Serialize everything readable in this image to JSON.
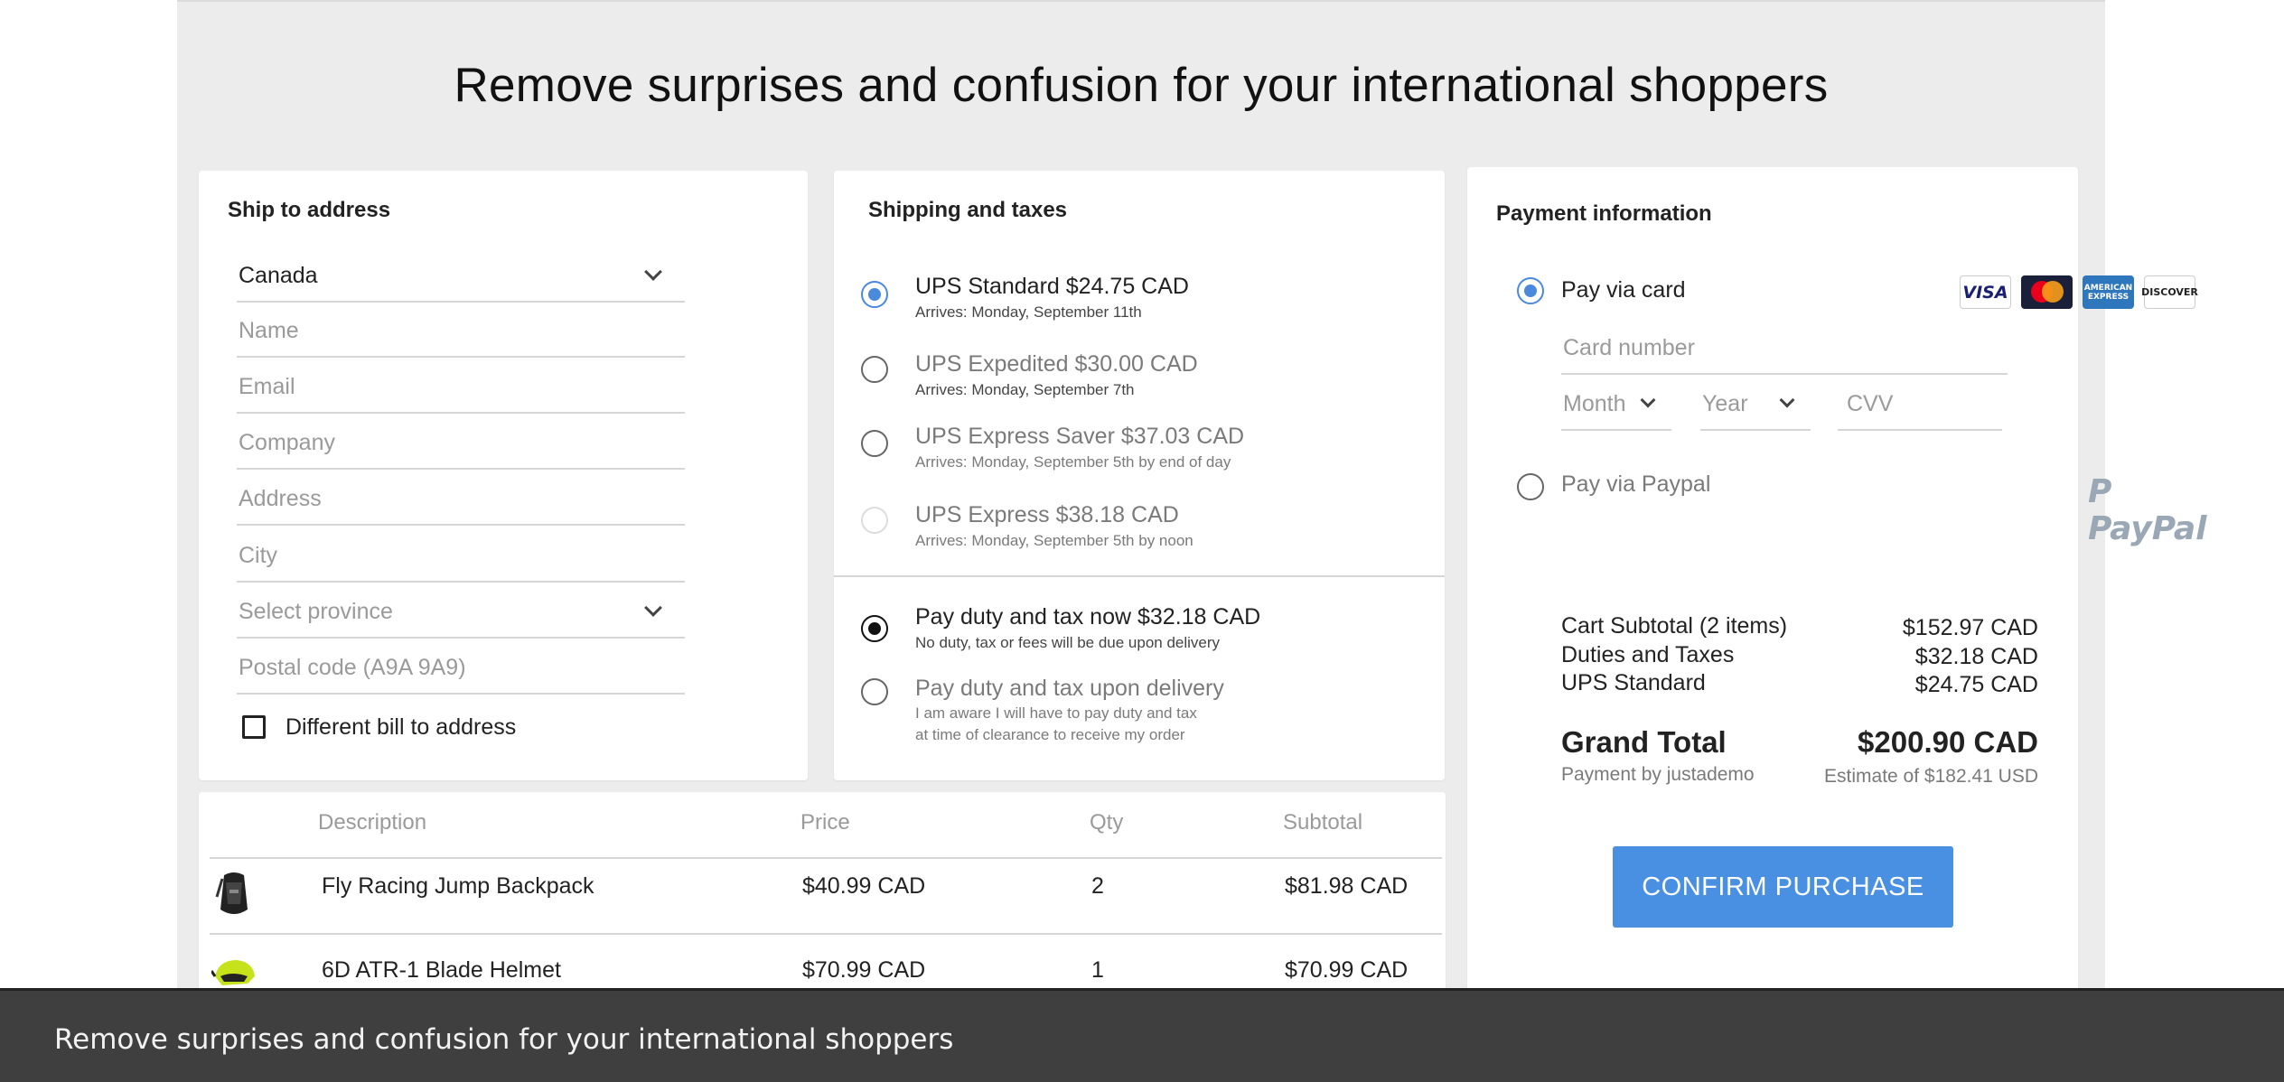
{
  "title": "Remove surprises and confusion for your international shoppers",
  "ship": {
    "heading": "Ship to address",
    "country": "Canada",
    "name_placeholder": "Name",
    "email_placeholder": "Email",
    "company_placeholder": "Company",
    "address_placeholder": "Address",
    "city_placeholder": "City",
    "province_placeholder": "Select province",
    "postal_placeholder": "Postal code (A9A 9A9)",
    "bill_label": "Different bill to address",
    "bill_checked": false
  },
  "shipping": {
    "heading": "Shipping and taxes",
    "options": [
      {
        "label": "UPS Standard $24.75 CAD",
        "sub": "Arrives: Monday, September 11th",
        "selected": true
      },
      {
        "label": "UPS Expedited $30.00 CAD",
        "sub": "Arrives: Monday, September 7th",
        "selected": false
      },
      {
        "label": "UPS Express Saver $37.03 CAD",
        "sub": "Arrives: Monday, September 5th by end of day",
        "selected": false
      },
      {
        "label": "UPS Express $38.18 CAD",
        "sub": "Arrives: Monday, September 5th by noon",
        "selected": false
      }
    ],
    "duty_options": [
      {
        "label": "Pay duty and tax now $32.18 CAD",
        "sub": "No duty, tax or fees will be due upon delivery",
        "selected": true
      },
      {
        "label": "Pay duty and tax upon delivery",
        "sub1": "I am aware I will have to pay duty and tax",
        "sub2": "at time of clearance to receive my order",
        "selected": false
      }
    ]
  },
  "payment": {
    "heading": "Payment information",
    "card_label": "Pay via card",
    "card_number_placeholder": "Card number",
    "month_placeholder": "Month",
    "year_placeholder": "Year",
    "cvv_placeholder": "CVV",
    "paypal_label": "Pay via Paypal",
    "paypal_logo": "PayPal",
    "card_brands": [
      "VISA",
      "MasterCard",
      "AMERICAN EXPRESS",
      "DISCOVER"
    ],
    "summary": [
      {
        "label": "Cart Subtotal (2 items)",
        "value": "$152.97 CAD"
      },
      {
        "label": "Duties and Taxes",
        "value": "$32.18 CAD"
      },
      {
        "label": "UPS Standard",
        "value": "$24.75 CAD"
      }
    ],
    "grand_total_label": "Grand Total",
    "grand_total_value": "$200.90 CAD",
    "payment_by": "Payment by justademo",
    "estimate": "Estimate of $182.41 USD",
    "confirm_label": "CONFIRM PURCHASE"
  },
  "table": {
    "headers": [
      "Description",
      "Price",
      "Qty",
      "Subtotal"
    ],
    "rows": [
      {
        "description": "Fly Racing Jump Backpack",
        "price": "$40.99 CAD",
        "qty": "2",
        "subtotal": "$81.98 CAD",
        "thumb": "backpack-thumbnail"
      },
      {
        "description": "6D ATR-1 Blade Helmet",
        "price": "$70.99 CAD",
        "qty": "1",
        "subtotal": "$70.99 CAD",
        "thumb": "helmet-thumbnail"
      }
    ]
  },
  "caption": "Remove surprises and confusion for your international shoppers",
  "colors": {
    "accent": "#4a90e2",
    "background": "#ececec",
    "caption_bar": "#3f3f3f"
  }
}
